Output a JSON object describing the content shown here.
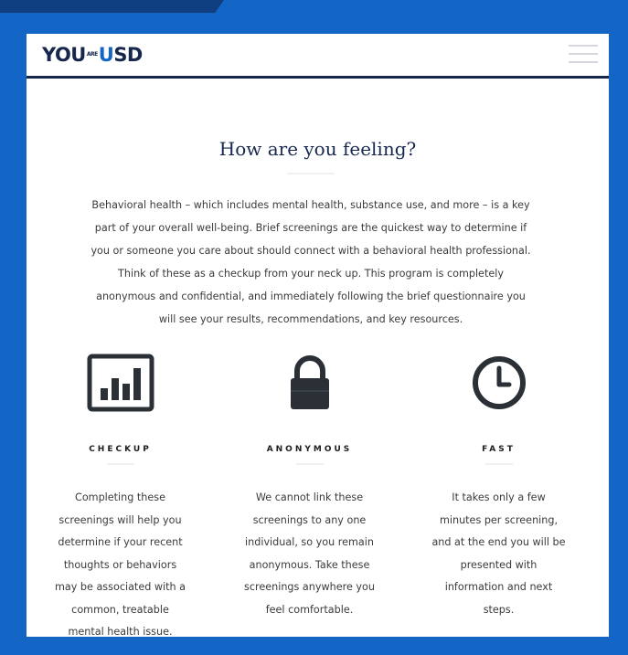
{
  "logo": {
    "you": "YOU",
    "are": "ARE",
    "u": "U",
    "sd": "SD"
  },
  "main": {
    "title": "How are you feeling?",
    "intro_lines": [
      "Behavioral health – which includes mental health, substance use, and more – is a key",
      "part of your overall well-being. Brief screenings are the quickest way to determine if",
      "you or someone you care about should connect with a behavioral health professional.",
      "Think of these as a checkup from your neck up. This program is completely",
      "anonymous and confidential, and immediately following the brief questionnaire you",
      "will see your results, recommendations, and key resources."
    ]
  },
  "features": [
    {
      "icon": "bar-chart-icon",
      "title": "CHECKUP",
      "text_lines": [
        "Completing these",
        "screenings will help you",
        "determine if your recent",
        "thoughts or behaviors",
        "may be associated with a",
        "common, treatable",
        "mental health issue."
      ]
    },
    {
      "icon": "lock-icon",
      "title": "ANONYMOUS",
      "text_lines": [
        "We cannot link these",
        "screenings to any one",
        "individual, so you remain",
        "anonymous. Take these",
        "screenings anywhere you",
        "feel comfortable."
      ]
    },
    {
      "icon": "clock-icon",
      "title": "FAST",
      "text_lines": [
        "It takes only a few",
        "minutes per screening,",
        "and at the end you will be",
        "presented with",
        "information and next",
        "steps."
      ]
    }
  ],
  "colors": {
    "background": "#1466c6",
    "navy": "#16264d",
    "text": "#3b3b3b"
  }
}
